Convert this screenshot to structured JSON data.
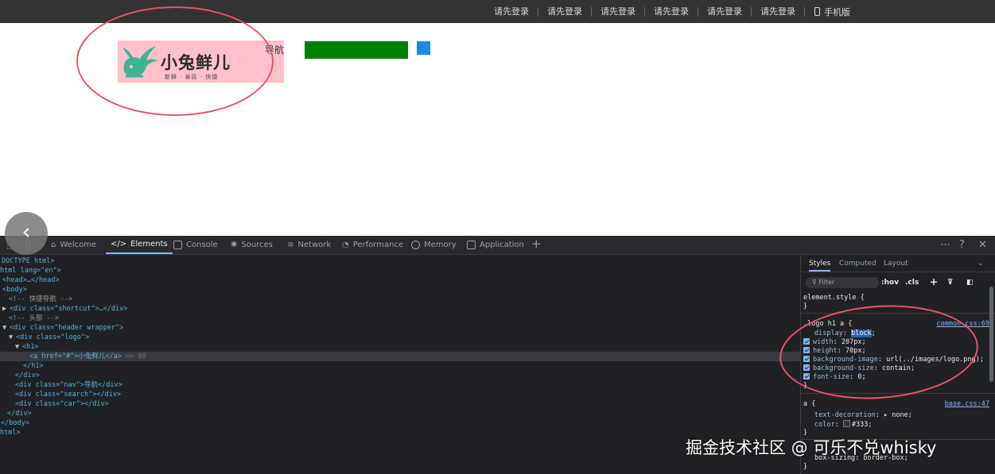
{
  "shortcut": {
    "links": [
      "请先登录",
      "请先登录",
      "请先登录",
      "请先登录",
      "请先登录",
      "请先登录"
    ],
    "mobile_label": "手机版"
  },
  "header": {
    "logo_title": "小兔鲜儿",
    "logo_subtitle": "新鲜 · 亲民 · 快捷",
    "nav_text": "导航"
  },
  "devtools": {
    "tabs": [
      "Welcome",
      "Elements",
      "Console",
      "Sources",
      "Network",
      "Performance",
      "Memory",
      "Application"
    ],
    "active_tab": "Elements",
    "dom": [
      "DOCTYPE html>",
      "html lang=\"en\">",
      "<head>…</head>",
      "<body>",
      "<!-- 快捷导航 -->",
      "<div class=\"shortcut\">…</div>",
      "<!-- 头部 -->",
      "<div class=\"header wrapper\">",
      "<div class=\"logo\">",
      "<h1>",
      "<a href=\"#\">小兔鲜儿</a>",
      "== $0",
      "</h1>",
      "</div>",
      "<div class=\"nav\">导航</div>",
      "<div class=\"search\"></div>",
      "<div class=\"car\"></div>",
      "</div>",
      "</body>",
      "html>"
    ],
    "styles_tabs": [
      "Styles",
      "Computed",
      "Layout"
    ],
    "filter_placeholder": "Filter",
    "hov_label": ":hov",
    "cls_label": ".cls",
    "rules": {
      "element_style": "element.style {",
      "close": "}",
      "logo_selector": ".logo h1 a {",
      "logo_source": "common.css:69",
      "logo_props": [
        {
          "name": "display",
          "value": "block"
        },
        {
          "name": "width",
          "value": "207px"
        },
        {
          "name": "height",
          "value": "70px"
        },
        {
          "name": "background-image",
          "value": "url(../images/logo.png)"
        },
        {
          "name": "background-size",
          "value": "contain"
        },
        {
          "name": "font-size",
          "value": "0"
        }
      ],
      "a_selector": "a {",
      "a_source": "base.css:47",
      "a_props": [
        {
          "name": "text-decoration",
          "value": "none"
        },
        {
          "name": "color",
          "value": "#333"
        }
      ],
      "last_prop": "box-sizing: border-box;"
    }
  },
  "watermark": "掘金技术社区 @ 可乐不兑whisky",
  "colors": {
    "shortcut_bg": "#333333",
    "logo_bg": "#ffc0cb",
    "search_box": "#008000",
    "cart_box": "#1e88e5",
    "annotation": "#e8546c",
    "devtools_bg": "#202124"
  }
}
